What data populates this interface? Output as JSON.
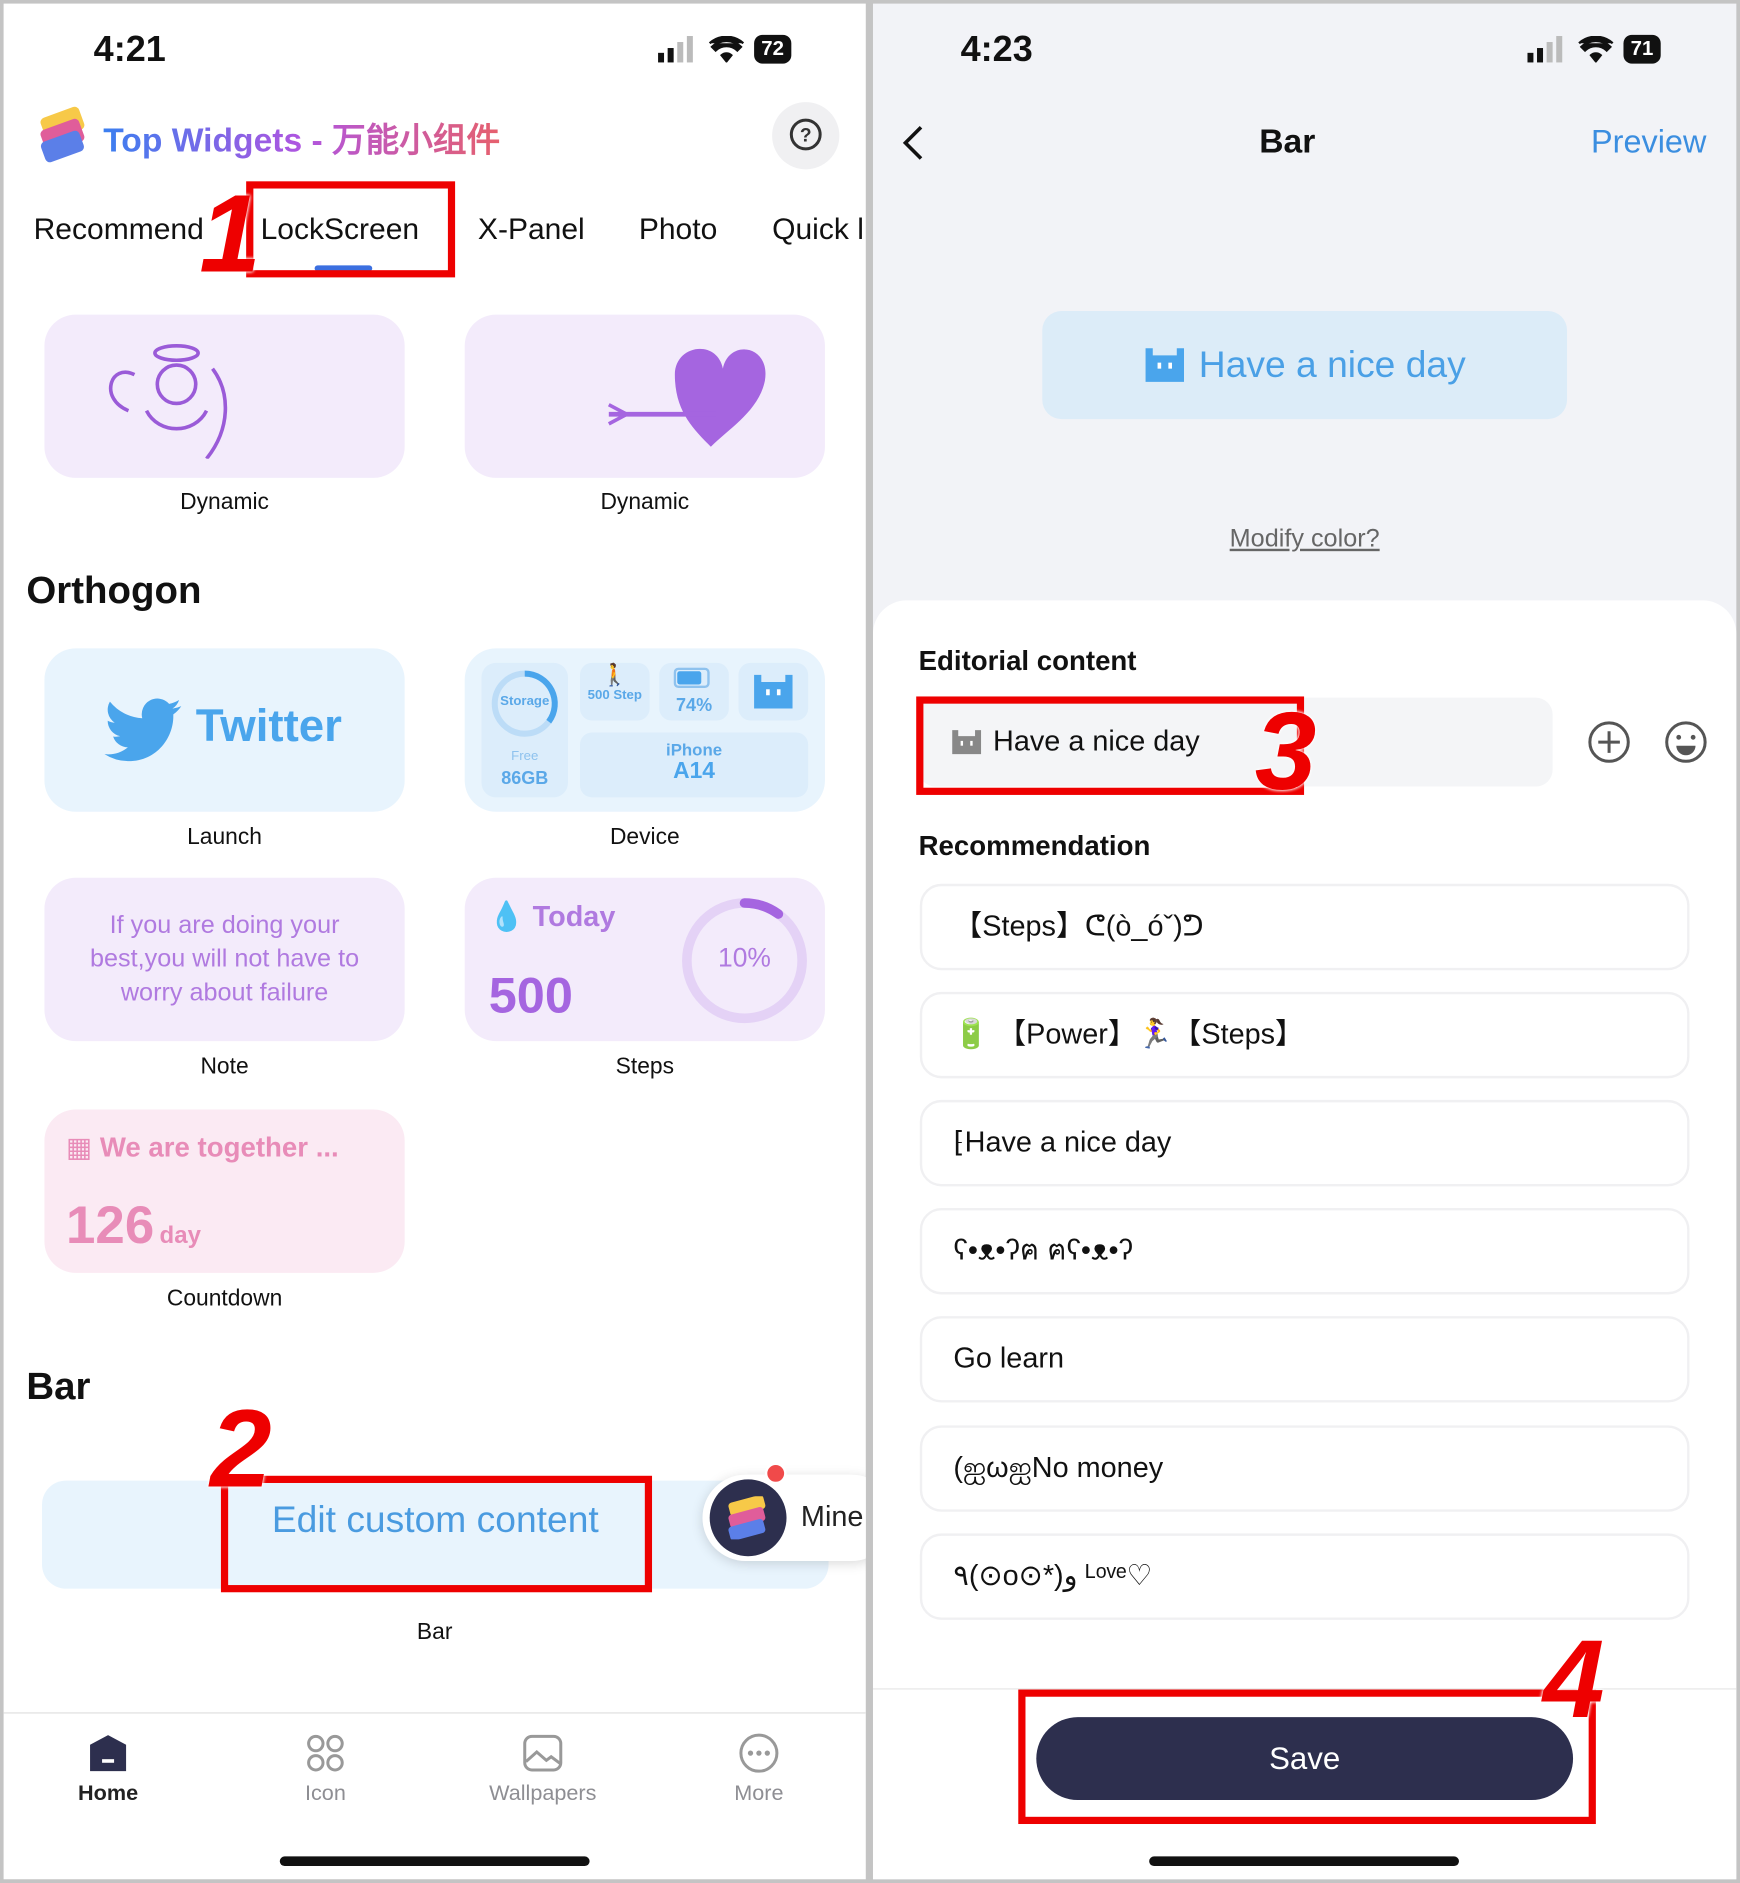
{
  "left": {
    "status": {
      "time": "4:21",
      "battery": "72"
    },
    "app_title": "Top Widgets - 万能小组件",
    "tabs": [
      "Recommend",
      "LockScreen",
      "X-Panel",
      "Photo",
      "Quick l"
    ],
    "active_tab": "LockScreen",
    "dynamic_cards": [
      {
        "label": "Dynamic"
      },
      {
        "label": "Dynamic"
      }
    ],
    "orthogon": {
      "heading": "Orthogon",
      "twitter": {
        "text": "Twitter",
        "label": "Launch"
      },
      "device": {
        "storage": "Storage",
        "free": "Free",
        "free_value": "86GB",
        "steps": "500 Step",
        "battery": "74%",
        "model_line1": "iPhone",
        "model_line2": "A14",
        "label": "Device"
      },
      "note": {
        "text": "If you are doing your best,you will not have to worry about failure",
        "label": "Note"
      },
      "steps": {
        "title": "Today",
        "value": "500",
        "percent": "10%",
        "progress": 0.1,
        "label": "Steps"
      },
      "countdown": {
        "title": "We are together ...",
        "value": "126",
        "unit": "day",
        "label": "Countdown"
      }
    },
    "bar": {
      "heading": "Bar",
      "button": "Edit custom content",
      "label": "Bar"
    },
    "mine": "Mine",
    "bottom_nav": [
      {
        "label": "Home",
        "icon": "home-icon",
        "active": true
      },
      {
        "label": "Icon",
        "icon": "grid-icon"
      },
      {
        "label": "Wallpapers",
        "icon": "image-icon"
      },
      {
        "label": "More",
        "icon": "more-icon"
      }
    ]
  },
  "right": {
    "status": {
      "time": "4:23",
      "battery": "71"
    },
    "title": "Bar",
    "preview": "Preview",
    "preview_text": "Have a nice day",
    "modify_color": "Modify color?",
    "editorial_heading": "Editorial content",
    "editorial_value": "Have a nice day",
    "recommendation_heading": "Recommendation",
    "recommendations": [
      "【Steps】ᕦ(ò_óˇ)ᕤ",
      "🔋 【Power】🏃‍♀️【Steps】",
      "⁅Have a nice day",
      "ʕ•ᴥ•ʔฅ  ฅʕ•ᴥ•ʔ",
      "Go learn",
      "(ஐωஐNo money",
      "٩(⊙o⊙*)و ᴸᵒᵛᵉ♡"
    ],
    "save": "Save"
  },
  "annotations": [
    "1",
    "2",
    "3",
    "4"
  ],
  "colors": {
    "annotation": "#ee0000",
    "accent_blue": "#3b8ee0",
    "save_button": "#2d2f4e",
    "lavender": "#f3ebfb"
  }
}
